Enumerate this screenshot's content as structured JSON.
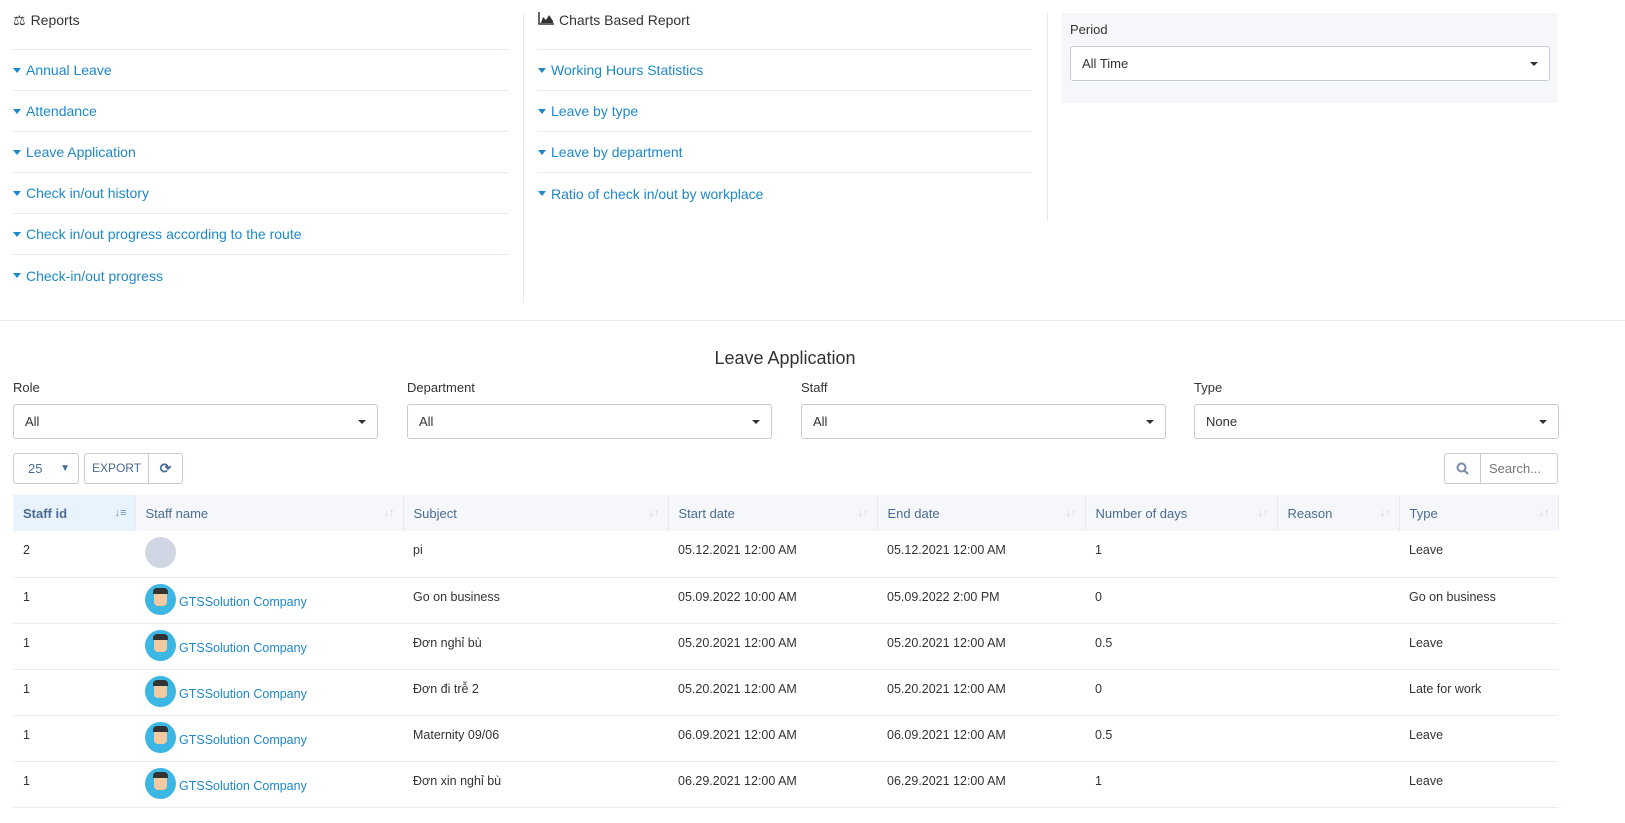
{
  "reports": {
    "title": "Reports",
    "items": [
      "Annual Leave",
      "Attendance",
      "Leave Application",
      "Check in/out history",
      "Check in/out progress according to the route",
      "Check-in/out progress"
    ]
  },
  "charts": {
    "title": "Charts Based Report",
    "items": [
      "Working Hours Statistics",
      "Leave by type",
      "Leave by department",
      "Ratio of check in/out by workplace"
    ]
  },
  "period": {
    "label": "Period",
    "value": "All Time"
  },
  "section_title": "Leave Application",
  "filters": [
    {
      "label": "Role",
      "value": "All"
    },
    {
      "label": "Department",
      "value": "All"
    },
    {
      "label": "Staff",
      "value": "All"
    },
    {
      "label": "Type",
      "value": "None"
    }
  ],
  "toolbar": {
    "page_size": "25",
    "export": "EXPORT",
    "search_placeholder": "Search..."
  },
  "table": {
    "headers": [
      "Staff id",
      "Staff name",
      "Subject",
      "Start date",
      "End date",
      "Number of days",
      "Reason",
      "Type"
    ],
    "rows": [
      {
        "id": "2",
        "name": "",
        "avatar": "blank",
        "subject": "pi",
        "start": "05.12.2021 12:00 AM",
        "end": "05.12.2021 12:00 AM",
        "days": "1",
        "reason": "",
        "type": "Leave"
      },
      {
        "id": "1",
        "name": "GTSSolution Company",
        "avatar": "man",
        "subject": "Go on business",
        "start": "05.09.2022 10:00 AM",
        "end": "05.09.2022 2:00 PM",
        "days": "0",
        "reason": "",
        "type": "Go on business"
      },
      {
        "id": "1",
        "name": "GTSSolution Company",
        "avatar": "man",
        "subject": "Đơn nghỉ bù",
        "start": "05.20.2021 12:00 AM",
        "end": "05.20.2021 12:00 AM",
        "days": "0.5",
        "reason": "",
        "type": "Leave"
      },
      {
        "id": "1",
        "name": "GTSSolution Company",
        "avatar": "man",
        "subject": "Đơn đi trễ 2",
        "start": "05.20.2021 12:00 AM",
        "end": "05.20.2021 12:00 AM",
        "days": "0",
        "reason": "",
        "type": "Late for work"
      },
      {
        "id": "1",
        "name": "GTSSolution Company",
        "avatar": "man",
        "subject": "Maternity 09/06",
        "start": "06.09.2021 12:00 AM",
        "end": "06.09.2021 12:00 AM",
        "days": "0.5",
        "reason": "",
        "type": "Leave"
      },
      {
        "id": "1",
        "name": "GTSSolution Company",
        "avatar": "man",
        "subject": "Đơn xin nghỉ bù",
        "start": "06.29.2021 12:00 AM",
        "end": "06.29.2021 12:00 AM",
        "days": "1",
        "reason": "",
        "type": "Leave"
      }
    ]
  }
}
